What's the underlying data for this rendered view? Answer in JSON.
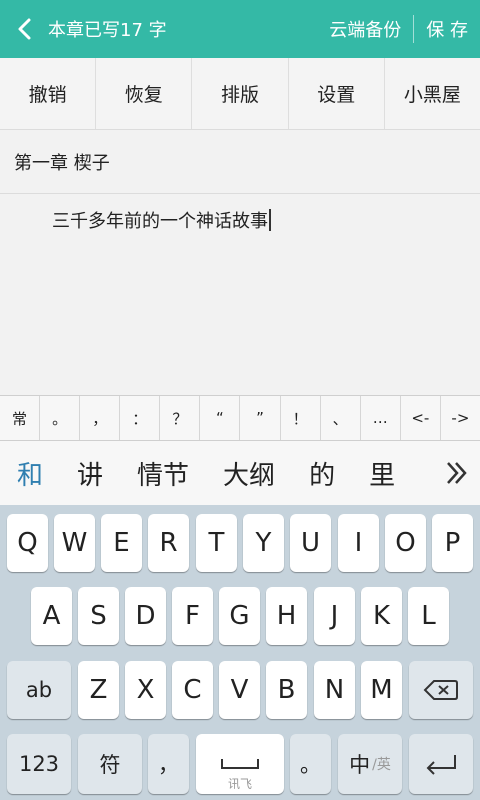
{
  "header": {
    "title": "本章已写17 字",
    "cloud_backup": "云端备份",
    "save": "保 存"
  },
  "toolbar": [
    "撤销",
    "恢复",
    "排版",
    "设置",
    "小黑屋"
  ],
  "editor": {
    "chapter_title": "第一章 楔子",
    "content": "三千多年前的一个神话故事"
  },
  "symbols": [
    "常",
    "。",
    "，",
    "：",
    "？",
    "“",
    "”",
    "！",
    "、",
    "…",
    "<-",
    "->"
  ],
  "candidates": [
    "和",
    "讲",
    "情节",
    "大纲",
    "的",
    "里"
  ],
  "keyboard": {
    "row1": [
      "Q",
      "W",
      "E",
      "R",
      "T",
      "Y",
      "U",
      "I",
      "O",
      "P"
    ],
    "row2": [
      "A",
      "S",
      "D",
      "F",
      "G",
      "H",
      "J",
      "K",
      "L"
    ],
    "row3": [
      "Z",
      "X",
      "C",
      "V",
      "B",
      "N",
      "M"
    ],
    "ab_key": "ab",
    "num_key": "123",
    "symbol_key": "符",
    "comma_key": "，",
    "period_key": "。",
    "space_hint": "讯飞",
    "lang_key": "中",
    "lang_sub": "/英"
  },
  "colors": {
    "header_bg": "#34b9a6",
    "keyboard_bg": "#c6d3dc",
    "candidate_highlight": "#2f7fb0"
  },
  "icons": {
    "back": "chevron-left-icon",
    "more_candidates": "double-chevron-right-icon",
    "backspace": "backspace-icon",
    "enter": "enter-icon"
  }
}
